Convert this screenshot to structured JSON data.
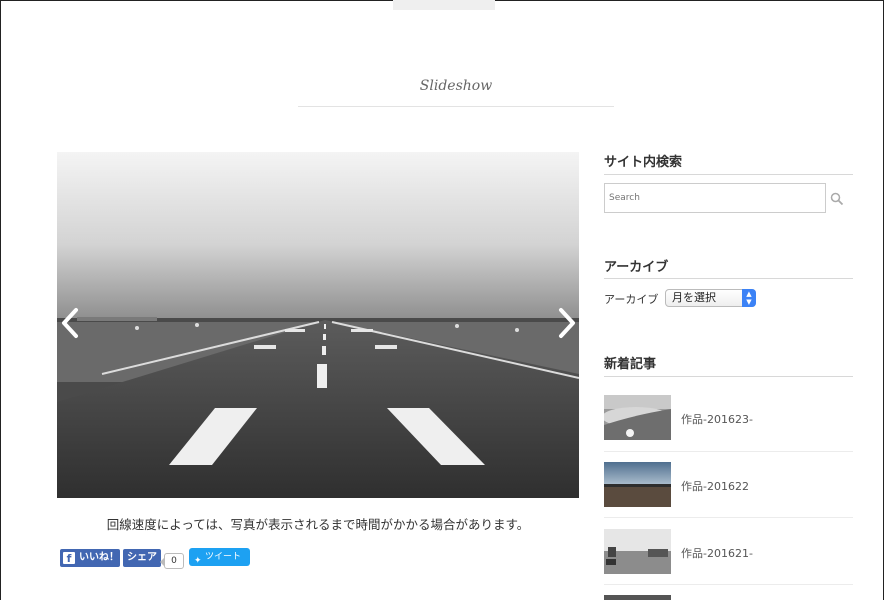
{
  "page": {
    "title": "Slideshow"
  },
  "slideshow": {
    "prev_icon": "chevron-left-icon",
    "next_icon": "chevron-right-icon",
    "caption": "回線速度によっては、写真が表示されるまで時間がかかる場合があります。"
  },
  "share": {
    "like_label": "いいね！",
    "share_label": "シェア",
    "share_count": "0",
    "tweet_label": "ツイート"
  },
  "sidebar": {
    "search": {
      "title": "サイト内検索",
      "placeholder": "Search"
    },
    "archive": {
      "title": "アーカイブ",
      "label": "アーカイブ",
      "selected": "月を選択"
    },
    "recent": {
      "title": "新着記事",
      "posts": [
        {
          "title": "作品-201623-"
        },
        {
          "title": "作品-201622"
        },
        {
          "title": "作品-201621-"
        }
      ]
    }
  },
  "colors": {
    "facebook": "#4267b2",
    "twitter": "#1da1f2",
    "select_accent": "#3b82f6"
  }
}
